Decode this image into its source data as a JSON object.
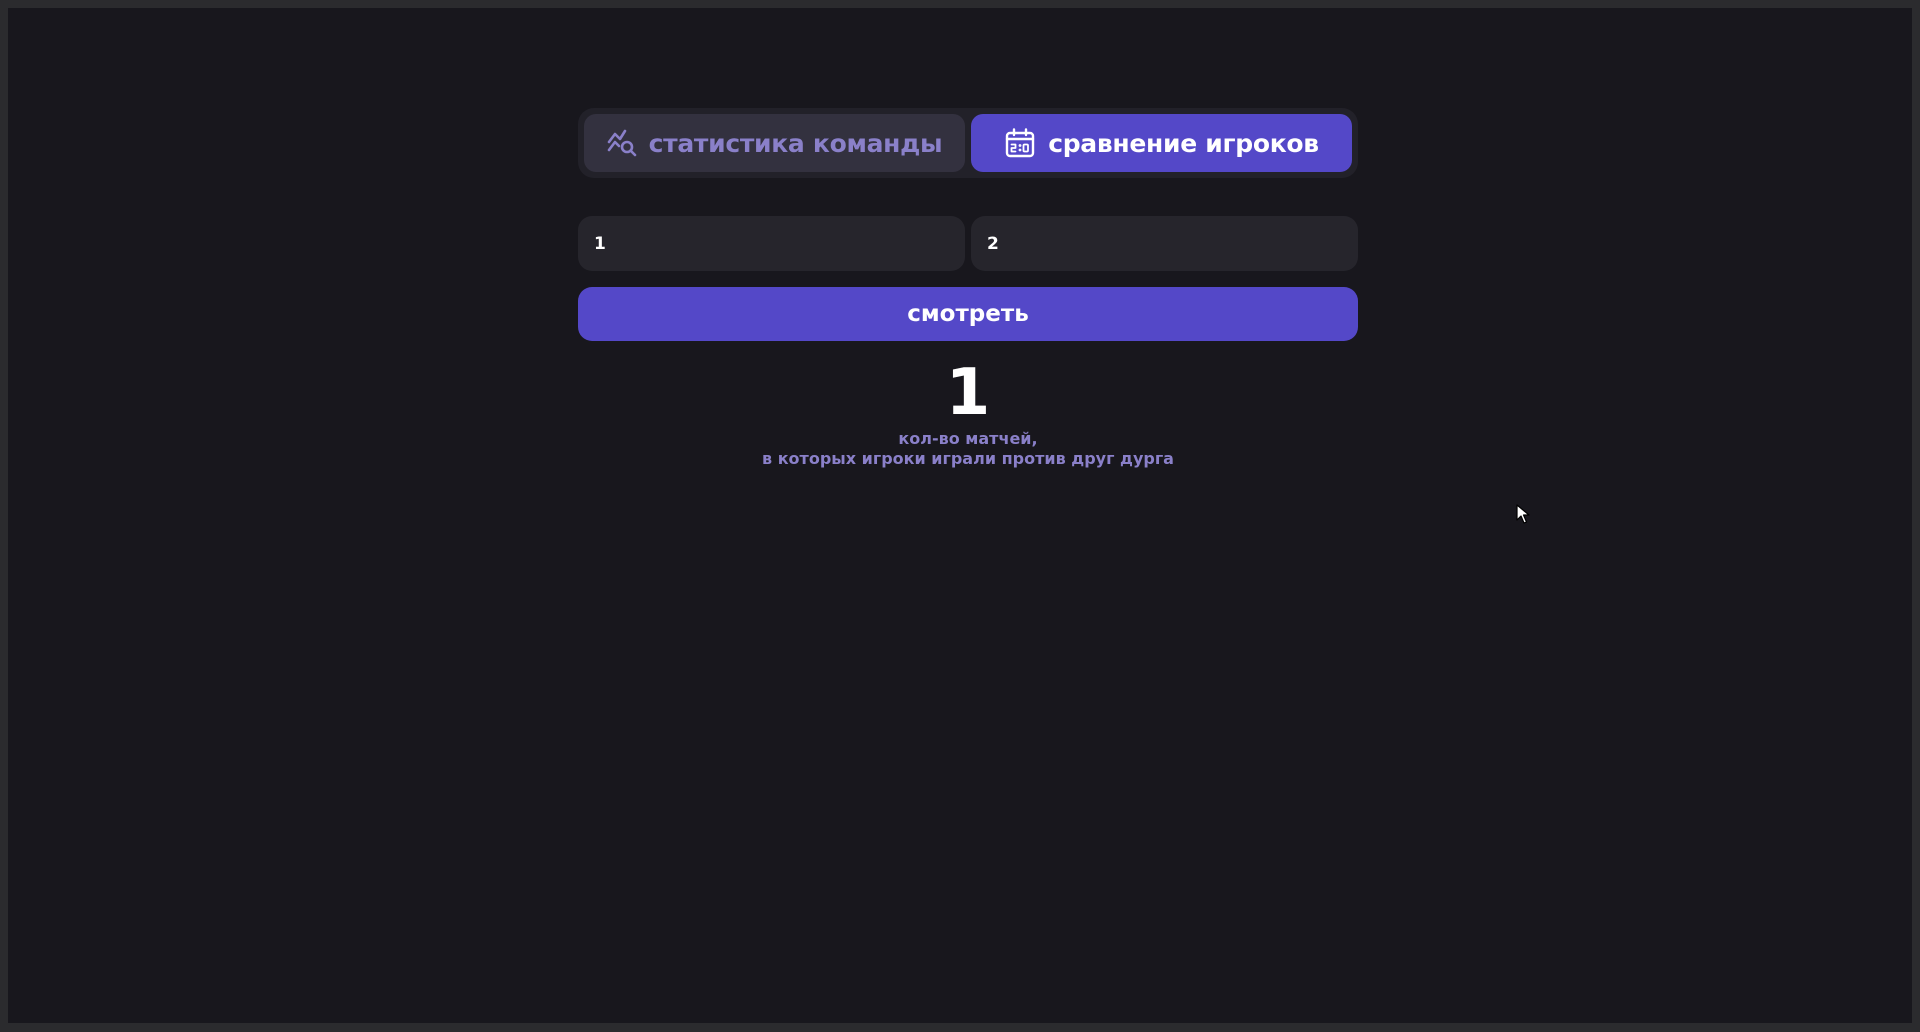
{
  "tabs": [
    {
      "label": "статистика команды",
      "icon": "chart-search-icon",
      "active": false
    },
    {
      "label": "сравнение игроков",
      "icon": "scoreboard-calendar-icon",
      "active": true
    }
  ],
  "inputs": {
    "player1_value": "1",
    "player2_value": "2"
  },
  "submit_label": "смотреть",
  "result": {
    "count": "1",
    "caption_line1": "кол-во матчей,",
    "caption_line2": "в которых игроки играли против друг дурга"
  },
  "colors": {
    "background": "#18171d",
    "accent": "#5448c8",
    "muted_accent": "#8a80c9",
    "field": "#26252c"
  }
}
